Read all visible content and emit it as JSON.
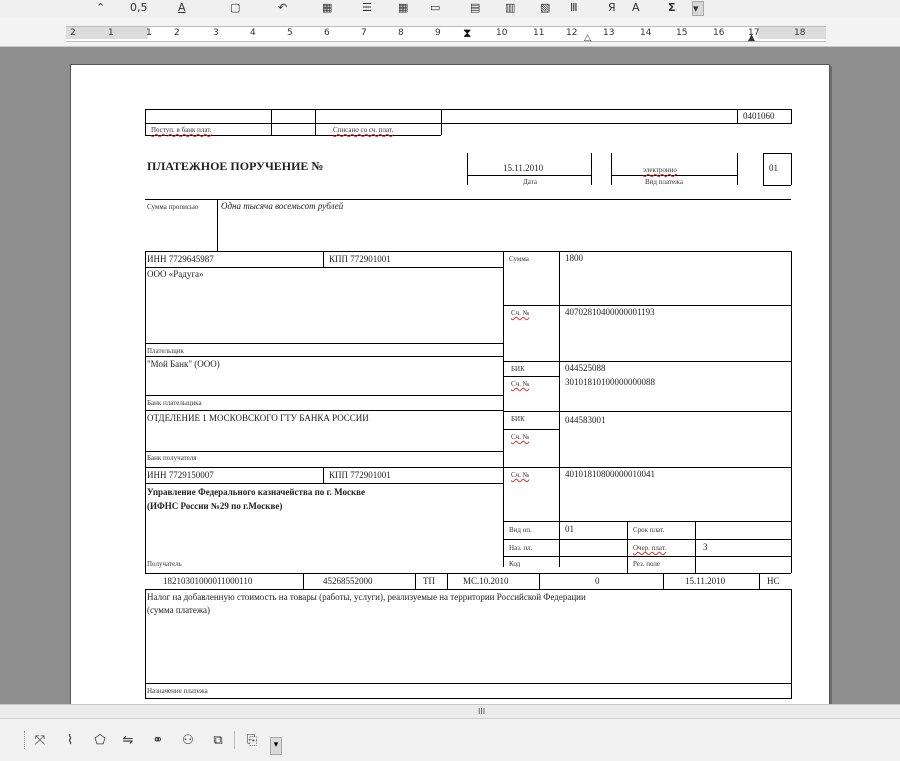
{
  "toolbar": {
    "items": [
      "0,5",
      "A",
      "Я",
      "A",
      "Σ"
    ]
  },
  "ruler": {
    "numbers": [
      "2",
      "1",
      "1",
      "2",
      "3",
      "4",
      "5",
      "6",
      "7",
      "8",
      "9",
      "10",
      "11",
      "12",
      "13",
      "14",
      "15",
      "16",
      "17",
      "18"
    ]
  },
  "form": {
    "code": "0401060",
    "received_label": "Поступ. в банк плат.",
    "debited_label": "Списано со сч. плат.",
    "title": "ПЛАТЕЖНОЕ ПОРУЧЕНИЕ №",
    "date_value": "15.11.2010",
    "date_label": "Дата",
    "payment_type_value": "электронно",
    "payment_type_label": "Вид платежа",
    "status_value": "01",
    "sum_words_label": "Сумма прописью",
    "sum_words_value": "Одна тысяча восемьсот рублей",
    "inn_payer": "ИНН  7729645987",
    "kpp_payer": "КПП  772901001",
    "sum_label": "Сумма",
    "sum_value": "1800",
    "payer_name": "ООО «Радуга»",
    "acc_label": "Сч. №",
    "payer_account": "40702810400000001193",
    "payer_label": "Плательщик",
    "payer_bank_name": "\"Мой Банк\" (ООО)",
    "bik_label": "БИК",
    "payer_bik": "044525088",
    "payer_corr_account": "30101810100000000088",
    "payer_bank_label": "Банк плательщика",
    "recipient_bank_name": "ОТДЕЛЕНИЕ 1 МОСКОВСКОГО ГТУ БАНКА РОССИИ",
    "recipient_bik": "044583001",
    "recipient_bank_label": "Банк получателя",
    "inn_recipient": "ИНН  7729150007",
    "kpp_recipient": "КПП  772901001",
    "recipient_account": "40101810800000010041",
    "recipient_name_line1": "Управление Федерального казначейства по г. Москве",
    "recipient_name_line2": "(ИФНС России №29 по г.Москве)",
    "op_type_label": "Вид оп.",
    "op_type_value": "01",
    "due_label": "Срок плат.",
    "purpose_label": "Наз. пл.",
    "order_label": "Очер. плат.",
    "order_value": "3",
    "code_label": "Код",
    "res_label": "Рез. поле",
    "recipient_label": "Получатель",
    "kbk": "18210301000011000110",
    "okato": "45268552000",
    "basis": "ТП",
    "period": "МС.10.2010",
    "doc_no": "0",
    "doc_date": "15.11.2010",
    "payment_kind": "НС",
    "purpose_text_line1": "Налог на добавленную стоимость на товары (работы, услуги), реализуемые на территории Российской Федерации",
    "purpose_text_line2": "(сумма платежа)",
    "purpose_footer_label": "Назначение платежа"
  },
  "scrollbar": {
    "grip": "III"
  }
}
